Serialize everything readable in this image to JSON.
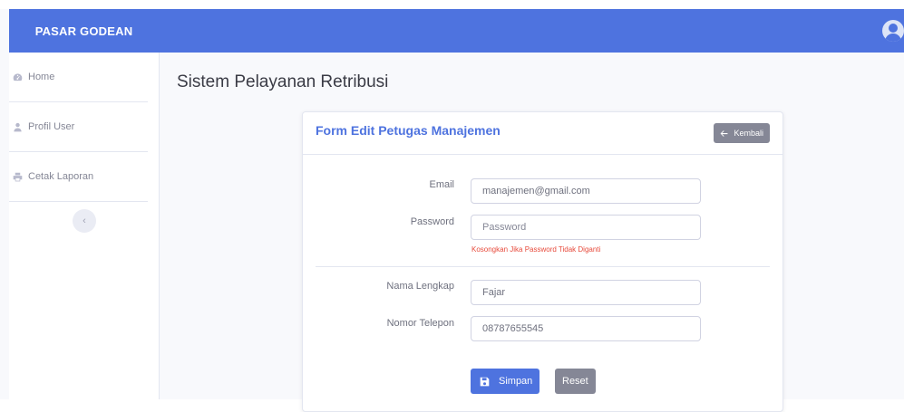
{
  "brand": {
    "title": "PASAR GODEAN"
  },
  "sidebar": {
    "items": [
      {
        "label": "Home",
        "icon": "dashboard-icon"
      },
      {
        "label": "Profil User",
        "icon": "user-icon"
      },
      {
        "label": "Cetak Laporan",
        "icon": "print-icon"
      }
    ],
    "toggle_glyph": "‹"
  },
  "main": {
    "page_title": "Sistem Pelayanan Retribusi"
  },
  "card": {
    "title": "Form Edit Petugas Manajemen",
    "back_label": "Kembali"
  },
  "form": {
    "email": {
      "label": "Email",
      "value": "manajemen@gmail.com"
    },
    "password": {
      "label": "Password",
      "placeholder": "Password",
      "hint": "Kosongkan Jika Password Tidak Diganti"
    },
    "full_name": {
      "label": "Nama Lengkap",
      "value": "Fajar"
    },
    "phone": {
      "label": "Nomor Telepon",
      "value": "08787655545"
    },
    "save_label": "Simpan",
    "reset_label": "Reset"
  },
  "colors": {
    "primary": "#4e73df",
    "secondary": "#858796",
    "danger": "#e74a3b"
  }
}
